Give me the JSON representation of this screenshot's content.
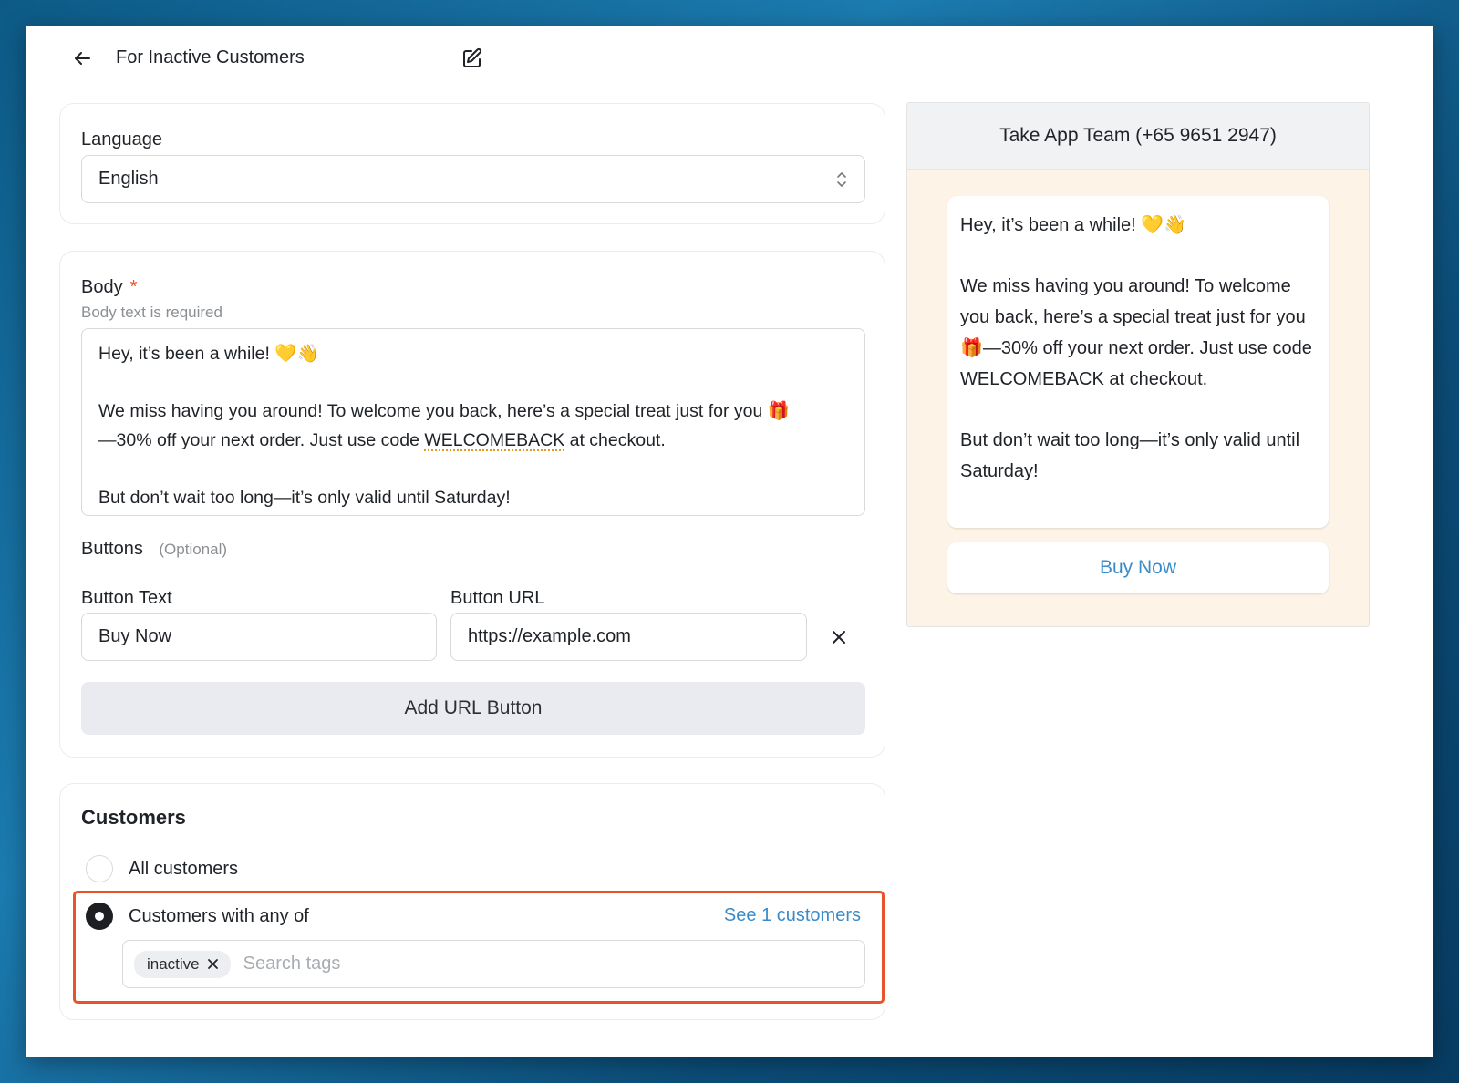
{
  "header": {
    "title": "For Inactive Customers",
    "back_icon": "arrow-left-icon",
    "edit_icon": "edit-icon"
  },
  "language": {
    "label": "Language",
    "selected": "English"
  },
  "body": {
    "label": "Body",
    "required_mark": "*",
    "error": "Body text is required",
    "text_line1": "Hey, it’s been a while! 💛👋",
    "text_line2a": "We miss having you around! To welcome you back, here’s a special treat just for you 🎁",
    "text_line2b_pre": "—30% off your next order. Just use code ",
    "text_code": "WELCOMEBACK",
    "text_line2b_post": " at checkout.",
    "text_line3": "But don’t wait too long—it’s only valid until Saturday!"
  },
  "buttons": {
    "label": "Buttons",
    "optional": "(Optional)",
    "text_label": "Button Text",
    "text_value": "Buy Now",
    "url_label": "Button URL",
    "url_value": "https://example.com",
    "add_label": "Add URL Button"
  },
  "customers": {
    "label": "Customers",
    "option_all": "All customers",
    "option_any": "Customers with any of",
    "see_link": "See 1 customers",
    "selected_option": "Customers with any of",
    "tags": [
      "inactive"
    ],
    "search_placeholder": "Search tags"
  },
  "preview": {
    "header": "Take App Team (+65 9651 2947)",
    "message": "Hey, it’s been a while! 💛👋\n\nWe miss having you around! To welcome you back, here’s a special treat just for you 🎁—30% off your next order. Just use code WELCOMEBACK at checkout.\n\nBut don’t wait too long—it’s only valid until Saturday!",
    "button": "Buy Now"
  },
  "colors": {
    "accent_link": "#3a8bc9",
    "highlight_border": "#e8542a",
    "required_star": "#e4572e",
    "preview_bg": "#fdf3e6"
  }
}
